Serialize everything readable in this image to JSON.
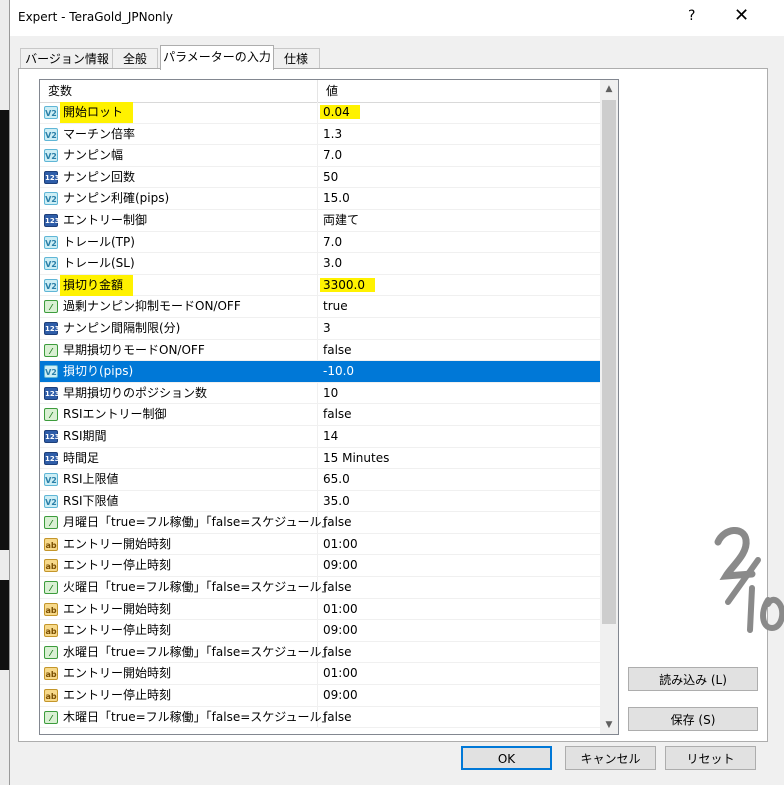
{
  "window": {
    "title": "Expert - TeraGold_JPNonly",
    "help_label": "?",
    "close_label": "✕"
  },
  "tabs": [
    {
      "label": "バージョン情報",
      "active": false
    },
    {
      "label": "全般",
      "active": false
    },
    {
      "label": "パラメーターの入力",
      "active": true
    },
    {
      "label": "仕様",
      "active": false
    }
  ],
  "grid": {
    "columns": [
      "変数",
      "値"
    ],
    "rows": [
      {
        "icon": "v2",
        "name": "開始ロット",
        "value": "0.04",
        "highlight": true
      },
      {
        "icon": "v2",
        "name": "マーチン倍率",
        "value": "1.3"
      },
      {
        "icon": "v2",
        "name": "ナンピン幅",
        "value": "7.0"
      },
      {
        "icon": "123",
        "name": "ナンピン回数",
        "value": "50"
      },
      {
        "icon": "v2",
        "name": "ナンピン利確(pips)",
        "value": "15.0"
      },
      {
        "icon": "123",
        "name": "エントリー制御",
        "value": "両建て"
      },
      {
        "icon": "v2",
        "name": "トレール(TP)",
        "value": "7.0"
      },
      {
        "icon": "v2",
        "name": "トレール(SL)",
        "value": "3.0"
      },
      {
        "icon": "v2",
        "name": "損切り金額",
        "value": "3300.0",
        "highlight": true
      },
      {
        "icon": "bool",
        "name": "過剰ナンピン抑制モードON/OFF",
        "value": "true"
      },
      {
        "icon": "123",
        "name": "ナンピン間隔制限(分)",
        "value": "3"
      },
      {
        "icon": "bool",
        "name": "早期損切りモードON/OFF",
        "value": "false"
      },
      {
        "icon": "v2",
        "name": "損切り(pips)",
        "value": "-10.0",
        "selected": true
      },
      {
        "icon": "123",
        "name": "早期損切りのポジション数",
        "value": "10"
      },
      {
        "icon": "bool",
        "name": "RSIエントリー制御",
        "value": "false"
      },
      {
        "icon": "123",
        "name": "RSI期間",
        "value": "14"
      },
      {
        "icon": "123",
        "name": "時間足",
        "value": "15 Minutes"
      },
      {
        "icon": "v2",
        "name": "RSI上限値",
        "value": "65.0"
      },
      {
        "icon": "v2",
        "name": "RSI下限値",
        "value": "35.0"
      },
      {
        "icon": "bool",
        "name": "月曜日「true=フル稼働」「false=スケジュール」",
        "value": "false"
      },
      {
        "icon": "ab",
        "name": "エントリー開始時刻",
        "value": "01:00"
      },
      {
        "icon": "ab",
        "name": "エントリー停止時刻",
        "value": "09:00"
      },
      {
        "icon": "bool",
        "name": "火曜日「true=フル稼働」「false=スケジュール」",
        "value": "false"
      },
      {
        "icon": "ab",
        "name": "エントリー開始時刻",
        "value": "01:00"
      },
      {
        "icon": "ab",
        "name": "エントリー停止時刻",
        "value": "09:00"
      },
      {
        "icon": "bool",
        "name": "水曜日「true=フル稼働」「false=スケジュール」",
        "value": "false"
      },
      {
        "icon": "ab",
        "name": "エントリー開始時刻",
        "value": "01:00"
      },
      {
        "icon": "ab",
        "name": "エントリー停止時刻",
        "value": "09:00"
      },
      {
        "icon": "bool",
        "name": "木曜日「true=フル稼働」「false=スケジュール」",
        "value": "false"
      }
    ]
  },
  "side_buttons": {
    "load": "読み込み (L)",
    "save": "保存 (S)"
  },
  "footer_buttons": {
    "ok": "OK",
    "cancel": "キャンセル",
    "reset": "リセット"
  },
  "colors": {
    "selection": "#0078d7",
    "highlight": "#fff200"
  }
}
